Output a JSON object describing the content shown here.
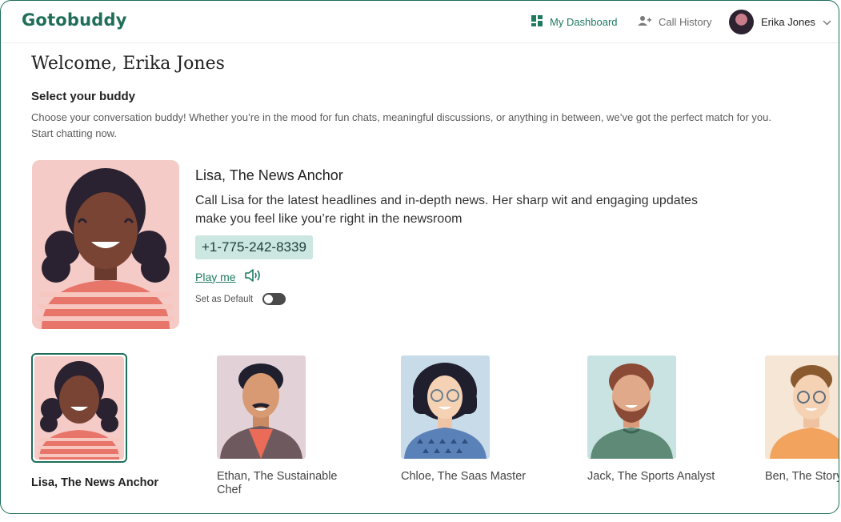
{
  "app": {
    "logo": "Gotobuddy"
  },
  "nav": {
    "dashboard": "My Dashboard",
    "history": "Call History",
    "user_name": "Erika Jones"
  },
  "page": {
    "welcome": "Welcome, Erika Jones",
    "select_title": "Select your buddy",
    "select_desc": "Choose your conversation buddy! Whether you’re in the mood for fun chats, meaningful discussions, or anything in between, we’ve got the perfect match for you. Start chatting now."
  },
  "featured": {
    "name": "Lisa, The News Anchor",
    "description": "Call Lisa for the latest headlines and in-depth news. Her sharp wit and engaging updates make you feel like you’re right in the newsroom",
    "phone": "+1-775-242-8339",
    "play_label": "Play me",
    "default_label": "Set as Default",
    "default_on": false
  },
  "buddies": [
    {
      "name": "Lisa, The News Anchor",
      "selected": true
    },
    {
      "name": "Ethan, The Sustainable Chef",
      "selected": false
    },
    {
      "name": "Chloe, The Saas Master",
      "selected": false
    },
    {
      "name": "Jack, The Sports Analyst",
      "selected": false
    },
    {
      "name": "Ben, The Storyteller",
      "selected": false
    }
  ],
  "colors": {
    "brand": "#1f6e5a",
    "accent": "#1f7a62",
    "phone_bg": "#cce6e2"
  }
}
